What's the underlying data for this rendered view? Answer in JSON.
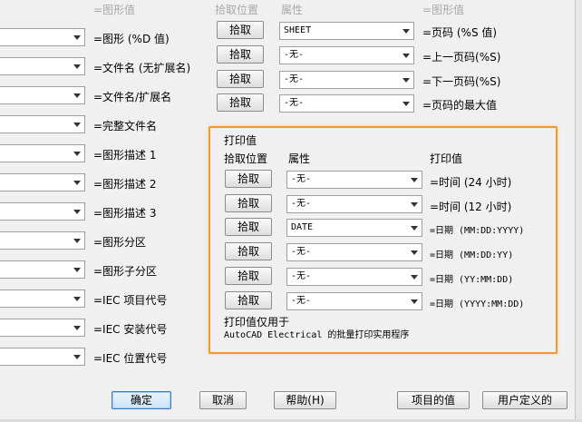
{
  "headers": {
    "value_left": "=图形值",
    "pick_pos": "拾取位置",
    "attribute": "属性",
    "value_right": "=图形值"
  },
  "left_rows": [
    {
      "label": "=图形 (%D 值)"
    },
    {
      "label": "=文件名 (无扩展名)"
    },
    {
      "label": "=文件名/扩展名"
    },
    {
      "label": "=完整文件名"
    },
    {
      "label": "=图形描述 1"
    },
    {
      "label": "=图形描述 2"
    },
    {
      "label": "=图形描述 3"
    },
    {
      "label": "=图形分区"
    },
    {
      "label": "=图形子分区"
    },
    {
      "label": "=IEC 项目代号"
    },
    {
      "label": "=IEC 安装代号"
    },
    {
      "label": "=IEC 位置代号"
    }
  ],
  "right_rows": [
    {
      "button": "拾取",
      "value": "SHEET",
      "label": "=页码 (%S 值)"
    },
    {
      "button": "拾取",
      "value": "-无-",
      "label": "=上一页码(%S)"
    },
    {
      "button": "拾取",
      "value": "-无-",
      "label": "=下一页码(%S)"
    },
    {
      "button": "拾取",
      "value": "-无-",
      "label": "=页码的最大值"
    }
  ],
  "print_group": {
    "title": "打印值",
    "col_pick": "拾取位置",
    "col_attr": "属性",
    "col_value": "打印值",
    "rows": [
      {
        "button": "拾取",
        "value": "-无-",
        "label": "=时间 (24 小时)"
      },
      {
        "button": "拾取",
        "value": "-无-",
        "label": "=时间 (12 小时)"
      },
      {
        "button": "拾取",
        "value": "DATE",
        "label": "=日期 (MM:DD:YYYY)"
      },
      {
        "button": "拾取",
        "value": "-无-",
        "label": "=日期 (MM:DD:YY)"
      },
      {
        "button": "拾取",
        "value": "-无-",
        "label": "=日期 (YY:MM:DD)"
      },
      {
        "button": "拾取",
        "value": "-无-",
        "label": "=日期 (YYYY:MM:DD)"
      }
    ],
    "note_line1": "打印值仅用于",
    "note_line2": "AutoCAD Electrical 的批量打印实用程序"
  },
  "footer": {
    "ok": "确定",
    "cancel": "取消",
    "help": "帮助(H)",
    "project_values": "项目的值",
    "user_defined": "用户定义的"
  },
  "colors": {
    "highlight": "#f19a2a",
    "default_button_border": "#3b7cc0"
  }
}
